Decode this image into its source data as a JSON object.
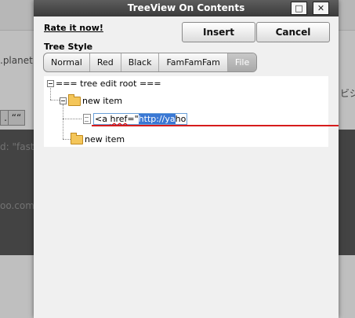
{
  "background": {
    "text_planet": ".planeti",
    "text_right_jp": "ビジ",
    "text_fast": "d: \"fast",
    "text_oo": "oo.com",
    "quote_button": "““",
    "left_button": "…"
  },
  "dialog": {
    "title": "TreeView On Contents",
    "maximize_glyph": "□",
    "close_glyph": "✕",
    "rate_link": "Rate it now!",
    "insert_label": "Insert",
    "cancel_label": "Cancel",
    "tree_style_label": "Tree Style",
    "style_tabs": [
      "Normal",
      "Red",
      "Black",
      "FamFamFam",
      "File"
    ],
    "active_style": "File",
    "tree": {
      "root_label": "=== tree edit root ===",
      "item1_label": "new item",
      "edit_prefix": "<a ",
      "edit_href": "href",
      "edit_eq": "=\"",
      "edit_selected": "http://ya",
      "edit_suffix": "ho",
      "item2_label": "new item"
    }
  }
}
